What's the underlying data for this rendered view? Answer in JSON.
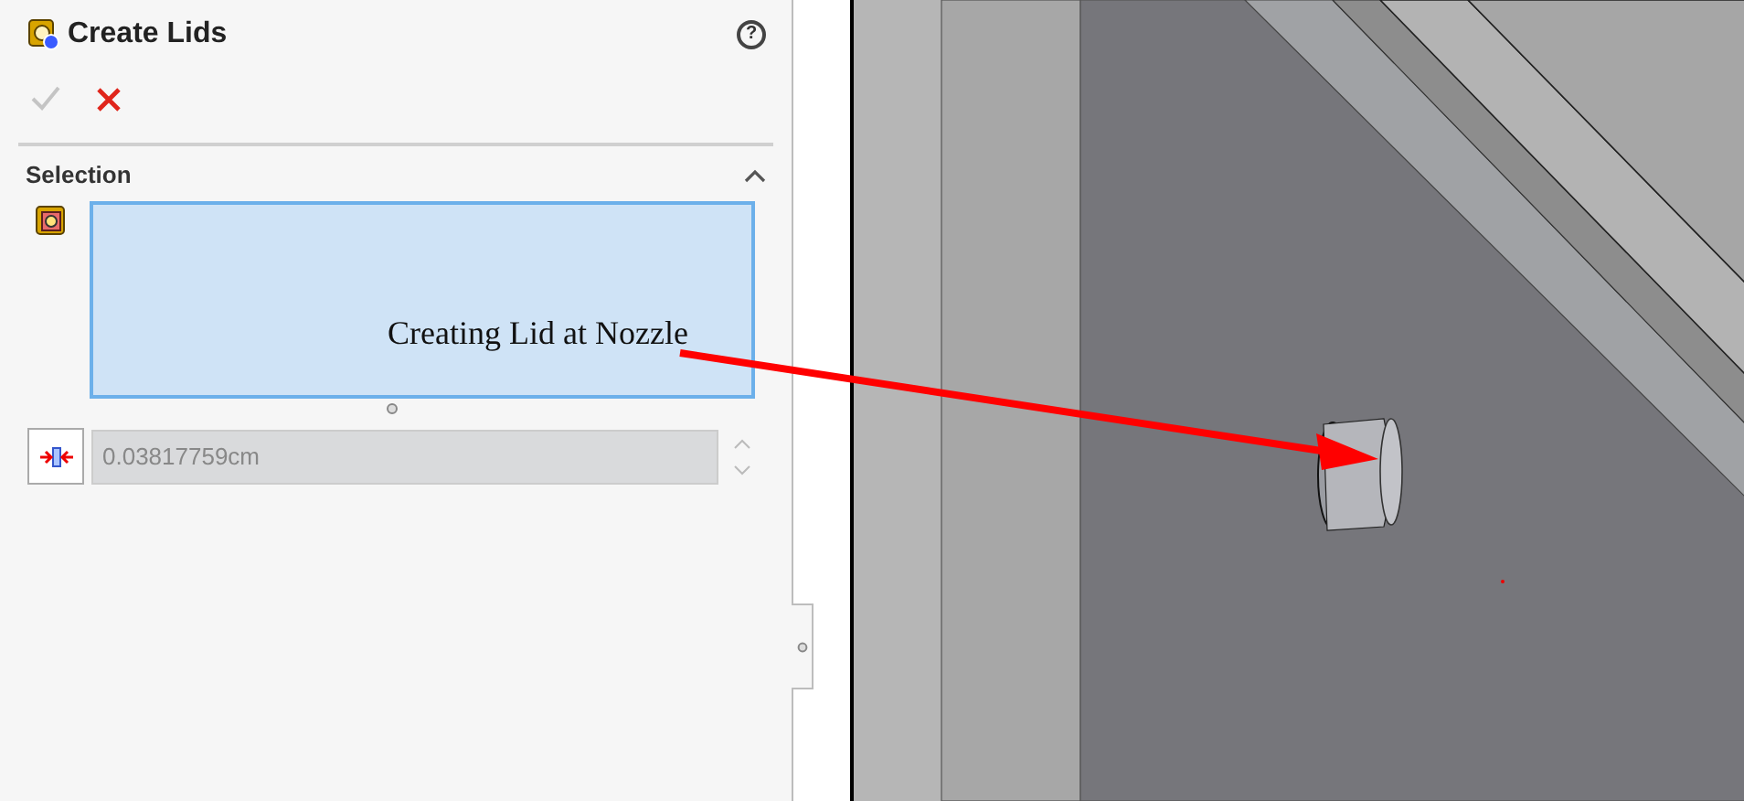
{
  "panel": {
    "title": "Create Lids",
    "help_label": "?",
    "actions": [
      {
        "kind": "confirm",
        "disabled": true
      },
      {
        "kind": "cancel",
        "disabled": false
      }
    ],
    "section": {
      "title": "Selection",
      "expanded": true
    },
    "selection_box": {
      "focused": true
    },
    "distance_field": {
      "value": "0.03817759cm",
      "disabled": true
    }
  },
  "annotation": {
    "text": "Creating Lid at Nozzle"
  }
}
